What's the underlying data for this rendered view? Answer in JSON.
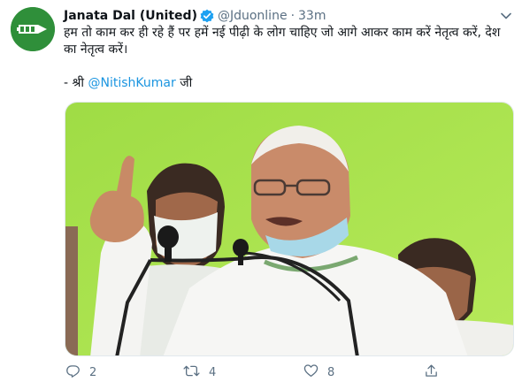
{
  "account": {
    "name": "Janata Dal (United)",
    "handle": "@Jduonline",
    "separator": "·",
    "time": "33m",
    "verified": true
  },
  "tweet": {
    "text": "हम तो काम कर ही रहे हैं पर हमें नई पीढ़ी के लोग चाहिए जो आगे आकर काम करें नेतृत्व करें, देश का नेतृत्व करें।",
    "credit_prefix": "- श्री ",
    "mention": "@NitishKumar",
    "credit_suffix": " जी"
  },
  "actions": {
    "reply_count": "2",
    "retweet_count": "4",
    "like_count": "8"
  },
  "colors": {
    "brand_green": "#2f8f3a",
    "link_blue": "#1b95e0",
    "muted": "#5b7083",
    "backdrop": "#a6e34f"
  },
  "icons": [
    "verified-icon",
    "chevron-down-icon",
    "reply-icon",
    "retweet-icon",
    "like-icon",
    "share-icon"
  ]
}
